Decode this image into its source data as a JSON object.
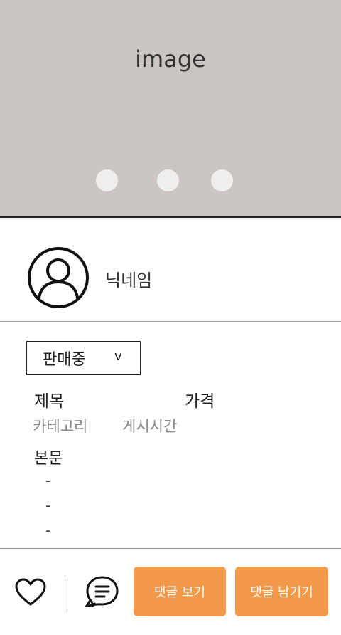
{
  "hero": {
    "label": "image",
    "dots": 3,
    "background": "#cbc5c4"
  },
  "seller": {
    "nickname": "닉네임",
    "avatar_icon": "user-avatar-icon"
  },
  "listing": {
    "status": "판매중",
    "status_chevron": "v",
    "title": "제목",
    "price": "가격",
    "category": "카테고리",
    "post_time": "게시시간",
    "body_label": "본문",
    "body_lines": [
      "-",
      "-",
      "-"
    ]
  },
  "actions": {
    "like_icon": "heart-icon",
    "chat_icon": "chat-bubble-icon",
    "view_comments": "댓글 보기",
    "leave_comment": "댓글 남기기",
    "accent": "#f2994a"
  }
}
